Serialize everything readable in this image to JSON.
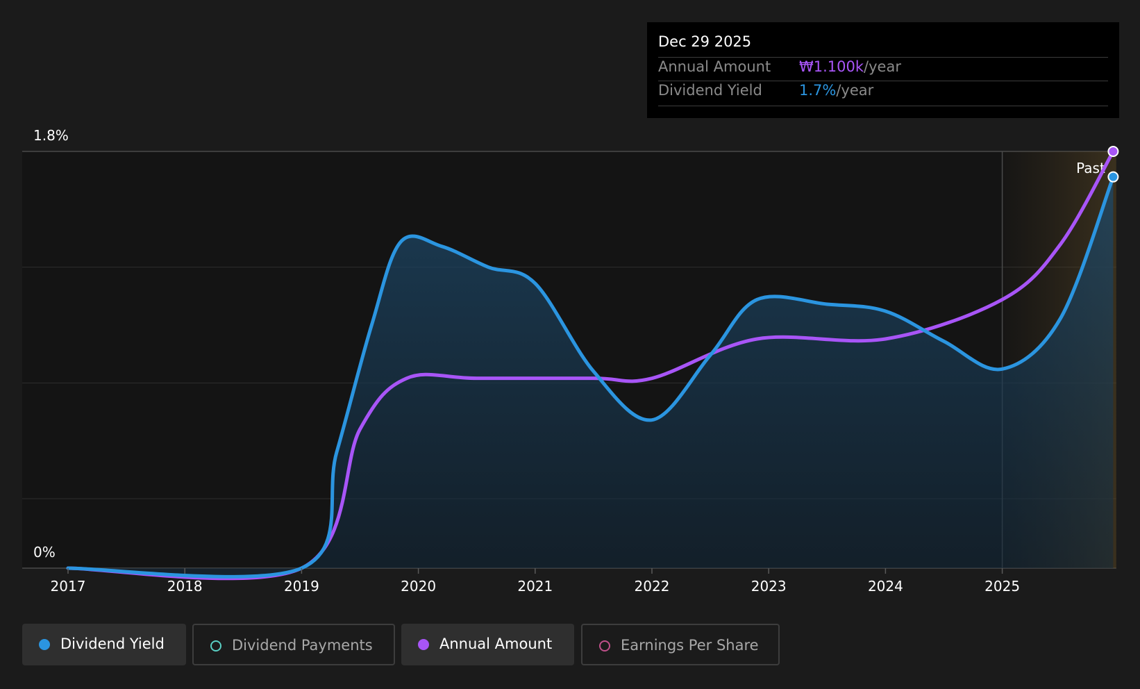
{
  "tooltip": {
    "date": "Dec 29 2025",
    "rows": [
      {
        "label": "Annual Amount",
        "value": "₩1.100k",
        "unit": "/year",
        "color": "#a855f7"
      },
      {
        "label": "Dividend Yield",
        "value": "1.7%",
        "unit": "/year",
        "color": "#2b95e0"
      }
    ]
  },
  "legend": [
    {
      "label": "Dividend Yield",
      "color": "#2b95e0",
      "active": true,
      "filled": true
    },
    {
      "label": "Dividend Payments",
      "color": "#5ad0c4",
      "active": false,
      "filled": false
    },
    {
      "label": "Annual Amount",
      "color": "#a855f7",
      "active": true,
      "filled": true
    },
    {
      "label": "Earnings Per Share",
      "color": "#c0508a",
      "active": false,
      "filled": false
    }
  ],
  "chart_data": {
    "type": "line",
    "x_ticks": [
      "2017",
      "2018",
      "2019",
      "2020",
      "2021",
      "2022",
      "2023",
      "2024",
      "2025"
    ],
    "y_tick_labels": [
      "1.8%",
      "0%"
    ],
    "ylim": [
      0,
      1.8
    ],
    "xlim": [
      2017,
      2026
    ],
    "gridlines": true,
    "past_label": "Past",
    "past_start": 2025,
    "series": [
      {
        "name": "Dividend Yield",
        "color": "#2b95e0",
        "area": true,
        "points": [
          [
            2017.0,
            0.0
          ],
          [
            2019.0,
            0.0
          ],
          [
            2019.3,
            0.5
          ],
          [
            2019.6,
            1.05
          ],
          [
            2019.85,
            1.41
          ],
          [
            2020.2,
            1.39
          ],
          [
            2020.6,
            1.3
          ],
          [
            2021.0,
            1.23
          ],
          [
            2021.5,
            0.85
          ],
          [
            2022.0,
            0.64
          ],
          [
            2022.5,
            0.92
          ],
          [
            2022.9,
            1.16
          ],
          [
            2023.5,
            1.14
          ],
          [
            2024.0,
            1.11
          ],
          [
            2024.5,
            0.98
          ],
          [
            2025.0,
            0.86
          ],
          [
            2025.5,
            1.08
          ],
          [
            2025.95,
            1.69
          ]
        ]
      },
      {
        "name": "Annual Amount",
        "color": "#a855f7",
        "area": false,
        "points": [
          [
            2017.0,
            0.0
          ],
          [
            2019.0,
            0.0
          ],
          [
            2019.5,
            0.6
          ],
          [
            2019.9,
            0.82
          ],
          [
            2020.5,
            0.82
          ],
          [
            2021.5,
            0.82
          ],
          [
            2022.0,
            0.82
          ],
          [
            2022.9,
            0.99
          ],
          [
            2024.0,
            0.99
          ],
          [
            2025.0,
            1.16
          ],
          [
            2025.5,
            1.4
          ],
          [
            2025.95,
            1.8
          ]
        ]
      }
    ]
  }
}
